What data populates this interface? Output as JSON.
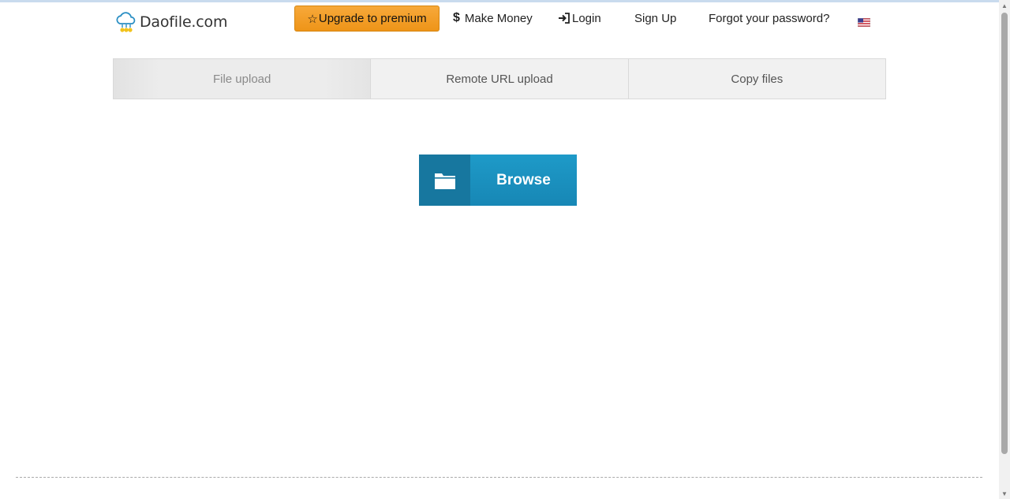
{
  "header": {
    "logo_text": "Daofile.com",
    "premium_label": "Upgrade to premium",
    "make_money_label": "Make Money",
    "login_label": "Login",
    "signup_label": "Sign Up",
    "forgot_label": "Forgot your password?",
    "language_icon": "us-flag-icon"
  },
  "tabs": [
    {
      "label": "File upload"
    },
    {
      "label": "Remote URL upload"
    },
    {
      "label": "Copy files"
    }
  ],
  "upload": {
    "browse_label": "Browse",
    "browse_icon": "folder-icon"
  },
  "colors": {
    "premium_button": "#f0981c",
    "browse_button": "#1a90c0",
    "browse_icon_bg": "#17779f"
  }
}
